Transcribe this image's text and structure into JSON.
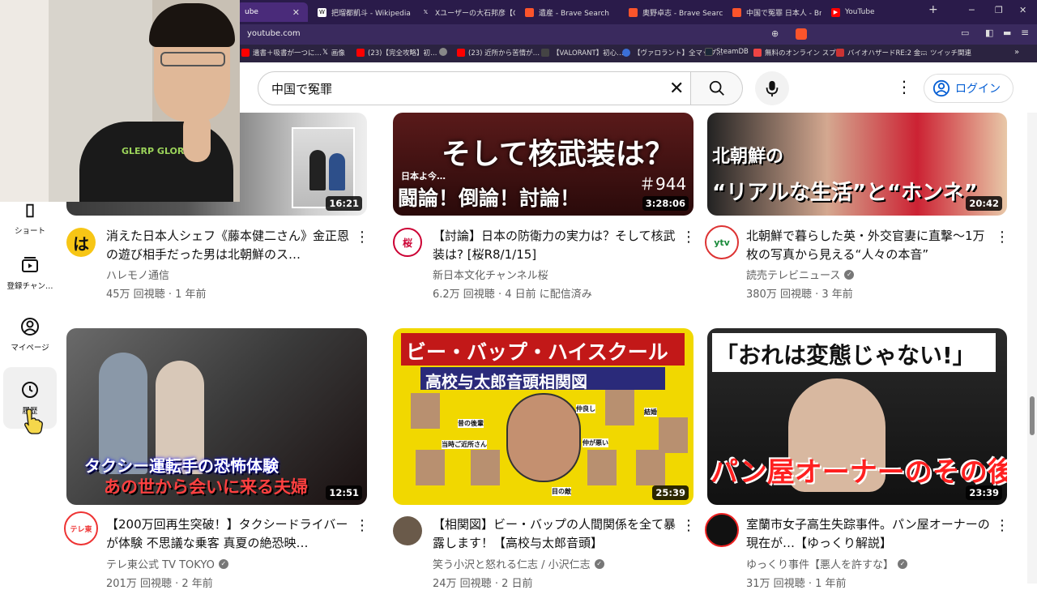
{
  "browser": {
    "tabs": [
      {
        "label": "ube",
        "active": true,
        "icon": "youtube-icon"
      },
      {
        "label": "把瑠都凱斗 - Wikipedia",
        "icon": "wikipedia-icon"
      },
      {
        "label": "Xユーザーの大石邦彦【CBC",
        "icon": "x-icon"
      },
      {
        "label": "遺産 - Brave Search",
        "icon": "brave-icon"
      },
      {
        "label": "奥野卓志 - Brave Search",
        "icon": "brave-icon"
      },
      {
        "label": "中国で冤罪 日本人 - Bra",
        "icon": "brave-icon"
      },
      {
        "label": "YouTube",
        "icon": "youtube-icon"
      }
    ],
    "new_tab": "+",
    "url": "youtube.com",
    "bookmarks": [
      {
        "label": "遺書＋吸書が一つに…",
        "icon": "youtube-icon",
        "color": "#ff0000"
      },
      {
        "label": "画像",
        "icon": "x-icon",
        "color": "#000000"
      },
      {
        "label": "(23)【完全攻略】初…",
        "icon": "youtube-icon",
        "color": "#ff0000"
      },
      {
        "label": "",
        "icon": "globe-icon",
        "color": "#888888"
      },
      {
        "label": "(23) 近所から苦情が…",
        "icon": "youtube-icon",
        "color": "#ff0000"
      },
      {
        "label": "【VALORANT】初心…",
        "icon": "page-icon",
        "color": "#333333"
      },
      {
        "label": "【ヴァロラント】全マップ…",
        "icon": "page-icon",
        "color": "#3b6fd6"
      },
      {
        "label": "SteamDB",
        "icon": "steam-icon",
        "color": "#1b2838"
      },
      {
        "label": "無料のオンライン スプ…",
        "icon": "grid-icon",
        "color": "#e44"
      },
      {
        "label": "バイオハザードRE:2 金…",
        "icon": "game-icon",
        "color": "#c33"
      },
      {
        "label": "ツイッチ関連",
        "icon": "folder-icon",
        "color": "#bbbbbb"
      }
    ]
  },
  "youtube": {
    "search_value": "中国で冤罪",
    "login_label": "ログイン",
    "sidebar": [
      {
        "label": "ショート",
        "icon": "shorts-icon"
      },
      {
        "label": "登録チャン…",
        "icon": "subscriptions-icon"
      },
      {
        "label": "マイページ",
        "icon": "account-icon"
      },
      {
        "label": "履歴",
        "icon": "history-icon"
      }
    ],
    "videos": [
      {
        "title": "消えた日本人シェフ《藤本健二さん》金正恩の遊び相手だった男は北朝鮮のス…",
        "channel": "ハレモノ通信",
        "verified": false,
        "views": "45万 回視聴",
        "age": "1 年前",
        "duration": "16:21",
        "avatar_text": "は"
      },
      {
        "title": "【討論】日本の防衛力の実力は？そして核武装は? [桜R8/1/15]",
        "channel": "新日本文化チャンネル桜",
        "verified": false,
        "views": "6.2万 回視聴",
        "age": "4 日前 に配信済み",
        "duration": "3:28:06",
        "avatar_text": "桜",
        "thumb_text_1": "そして核武装は？",
        "thumb_text_2": "闘論！倒論！討論！",
        "thumb_text_3": "日本よ今…",
        "thumb_text_4": "＃944"
      },
      {
        "title": "北朝鮮で暮らした英・外交官妻に直撃〜1万枚の写真から見える“人々の本音”",
        "channel": "読売テレビニュース",
        "verified": true,
        "views": "380万 回視聴",
        "age": "3 年前",
        "duration": "20:42",
        "avatar_text": "ytv",
        "thumb_text_1": "北朝鮮の",
        "thumb_text_2": "“リアルな生活”と“ホンネ”"
      },
      {
        "title": "【200万回再生突破！】タクシードライバーが体験 不思議な乗客 真夏の絶恐映…",
        "channel": "テレ東公式 TV TOKYO",
        "verified": true,
        "views": "201万 回視聴",
        "age": "2 年前",
        "duration": "12:51",
        "avatar_text": "テレ東",
        "thumb_text_1": "タクシー運転手の恐怖体験",
        "thumb_text_2": "あの世から会いに来る夫婦"
      },
      {
        "title": "【相関図】ビー・バップの人間関係を全て暴露します！【高校与太郎音頭】",
        "channel": "笑う小沢と怒れる仁志 / 小沢仁志",
        "verified": true,
        "views": "24万 回視聴",
        "age": "2 日前",
        "duration": "25:39",
        "avatar_text": "",
        "thumb_text_1": "ビー・バップ・ハイスクール",
        "thumb_text_2": "高校与太郎音頭相関図",
        "thumb_labels": [
          "昔の後輩",
          "当時ご近所さん",
          "仲良し",
          "結婚",
          "仲が悪い",
          "目の敵"
        ]
      },
      {
        "title": "室蘭市女子高生失踪事件。パン屋オーナーの現在が…【ゆっくり解説】",
        "channel": "ゆっくり事件【悪人を許すな】",
        "verified": true,
        "views": "31万 回視聴",
        "age": "1 年前",
        "duration": "23:39",
        "avatar_text": "",
        "thumb_text_1": "「おれは変態じゃない!」",
        "thumb_text_2": "パン屋オーナーのその後"
      }
    ]
  },
  "webcam": {
    "shirt_text": "GLERP GLORP"
  }
}
